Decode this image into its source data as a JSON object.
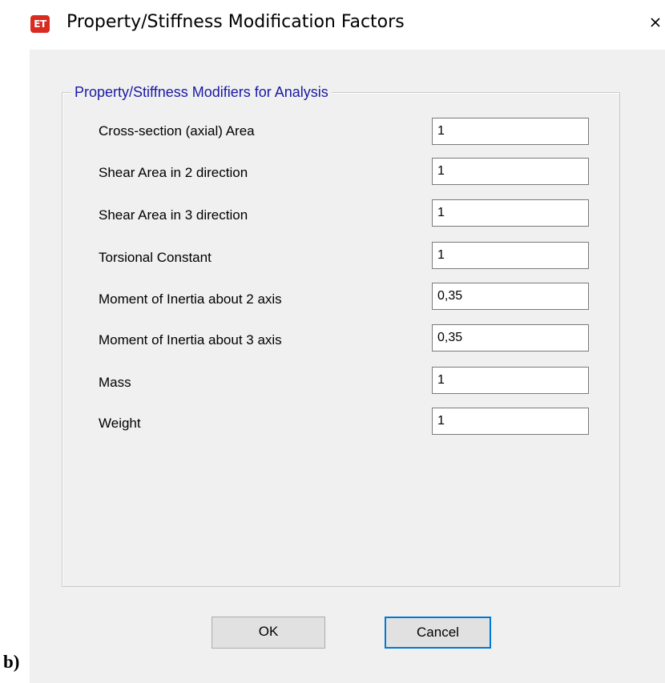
{
  "window": {
    "app_icon_text": "ET",
    "title": "Property/Stiffness Modification Factors",
    "close_icon": "close-icon"
  },
  "group": {
    "legend": "Property/Stiffness Modifiers for Analysis",
    "rows": [
      {
        "label": "Cross-section (axial) Area",
        "value": "1"
      },
      {
        "label": "Shear Area in 2 direction",
        "value": "1"
      },
      {
        "label": "Shear Area in 3 direction",
        "value": "1"
      },
      {
        "label": "Torsional Constant",
        "value": "1"
      },
      {
        "label": "Moment of Inertia about 2 axis",
        "value": "0,35"
      },
      {
        "label": "Moment of Inertia about 3 axis",
        "value": "0,35"
      },
      {
        "label": "Mass",
        "value": "1"
      },
      {
        "label": "Weight",
        "value": "1"
      }
    ]
  },
  "buttons": {
    "ok_label": "OK",
    "cancel_label": "Cancel"
  },
  "caption": "b)",
  "colors": {
    "app_icon": "#d92b20",
    "legend_text": "#1a1aa6",
    "dialog_background": "#f0f0f0",
    "focus_border": "#0078d7"
  }
}
